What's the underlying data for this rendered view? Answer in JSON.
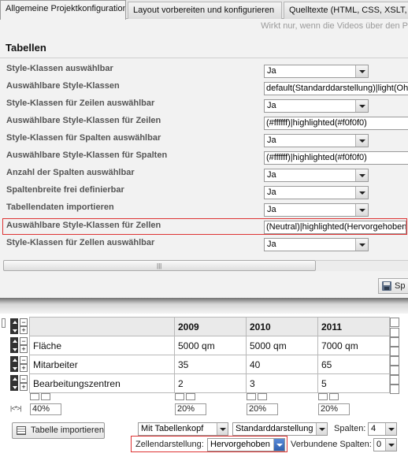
{
  "tabs": [
    {
      "label": "Allgemeine Projektkonfiguration",
      "active": true
    },
    {
      "label": "Layout vorbereiten und konfigurieren",
      "active": false
    },
    {
      "label": "Quelltexte (HTML, CSS, XSLT, F",
      "active": false
    }
  ],
  "hint": "Wirkt nur, wenn die Videos über den P",
  "section_title": "Tabellen",
  "settings": [
    {
      "label": "Style-Klassen auswählbar",
      "value": "Ja"
    },
    {
      "label": "Auswählbare Style-Klassen",
      "value": "default(Standarddarstellung)|light(Ohn"
    },
    {
      "label": "Style-Klassen für Zeilen auswählbar",
      "value": "Ja"
    },
    {
      "label": "Auswählbare Style-Klassen für Zeilen",
      "value": "(#ffffff)|highlighted(#f0f0f0)"
    },
    {
      "label": "Style-Klassen für Spalten auswählbar",
      "value": "Ja"
    },
    {
      "label": "Auswählbare Style-Klassen für Spalten",
      "value": "(#ffffff)|highlighted(#f0f0f0)"
    },
    {
      "label": "Anzahl der Spalten auswählbar",
      "value": "Ja"
    },
    {
      "label": "Spaltenbreite frei definierbar",
      "value": "Ja"
    },
    {
      "label": "Tabellendaten importieren",
      "value": "Ja"
    },
    {
      "label": "Auswählbare Style-Klassen für Zellen",
      "value": "(Neutral)|highlighted(Hervorgehoben)"
    },
    {
      "label": "Style-Klassen für Zellen auswählbar",
      "value": "Ja"
    }
  ],
  "scroll_grip": "|||",
  "save_label": "Sp",
  "table": {
    "header": [
      "",
      "2009",
      "2010",
      "2011"
    ],
    "rows": [
      [
        "Fläche",
        "5000 qm",
        "5000 qm",
        "7000 qm"
      ],
      [
        "Mitarbeiter",
        "35",
        "40",
        "65"
      ],
      [
        "Bearbeitungszentren",
        "2",
        "3",
        "5"
      ]
    ],
    "column_widths": [
      "40%",
      "20%",
      "20%",
      "20%"
    ]
  },
  "width_icon": "|<*>|",
  "import_label": "Tabelle importieren",
  "header_mode": "Mit Tabellenkopf",
  "display_mode": "Standarddarstellung",
  "columns_label": "Spalten:",
  "columns_value": "4",
  "cell_display_label": "Zellendarstellung:",
  "cell_display_value": "Hervorgehoben",
  "merged_columns_label": "Verbundene Spalten:",
  "merged_columns_value": "0"
}
